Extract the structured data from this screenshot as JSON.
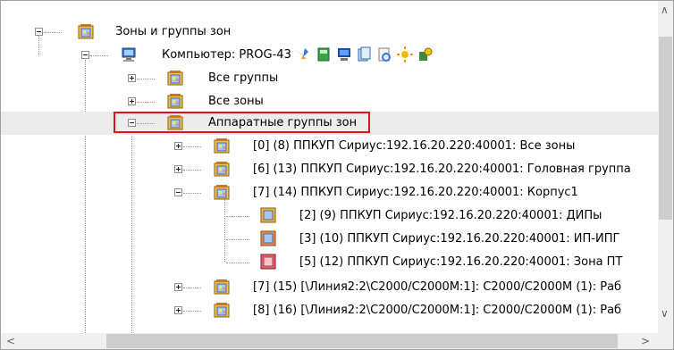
{
  "tree": {
    "root": {
      "label": "Зоны и группы зон",
      "icon": "zone-group-icon"
    },
    "computer": {
      "label": "Компьютер: PROG-43",
      "icon": "computer-icon",
      "tools": [
        "warning-arrow-icon",
        "notebook-icon",
        "monitor-icon",
        "documents-icon",
        "refresh-icon",
        "sun-icon",
        "keys-icon"
      ]
    },
    "all_groups": {
      "label": "Все группы"
    },
    "all_zones": {
      "label": "Все зоны"
    },
    "hw_groups": {
      "label": "Аппаратные группы зон"
    },
    "group_items": [
      {
        "label": "[0] (8) ППКУП Сириус:192.16.20.220:40001: Все зоны"
      },
      {
        "label": "[6] (13) ППКУП Сириус:192.16.20.220:40001: Головная группа"
      },
      {
        "label": "[7] (14) ППКУП Сириус:192.16.20.220:40001: Корпус1"
      }
    ],
    "zone_items": [
      {
        "label": "[2] (9) ППКУП Сириус:192.16.20.220:40001: ДИПы",
        "color": "#f2b43a"
      },
      {
        "label": "[3] (10) ППКУП Сириус:192.16.20.220:40001: ИП-ИПГ",
        "color": "#e8894a"
      },
      {
        "label": "[5] (12) ППКУП Сириус:192.16.20.220:40001: Зона ПТ",
        "color": "#e85a6a"
      }
    ],
    "line_items": [
      {
        "label": "[7] (15) [\\Линия2:2\\C2000/C2000M:1]: C2000/C2000M (1): Раб"
      },
      {
        "label": "[8] (16) [\\Линия2:2\\C2000/C2000M:1]: C2000/C2000M (1): Раб"
      }
    ]
  },
  "scroll": {
    "up": "∧",
    "down": "∨",
    "left": "<",
    "right": ">"
  },
  "colors": {
    "highlight_border": "#e01020",
    "selected_row": "#ececec"
  }
}
